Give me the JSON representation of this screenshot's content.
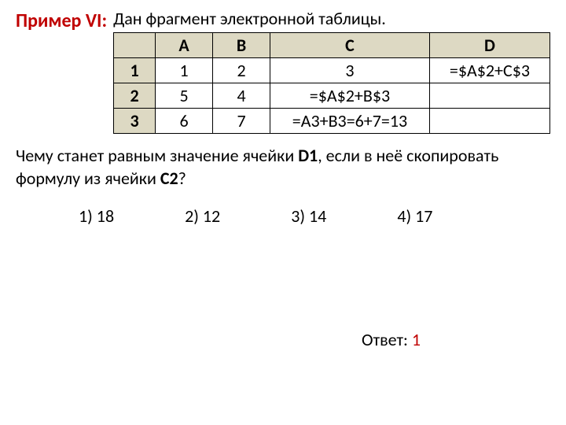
{
  "header": {
    "example_label": "Пример VI:",
    "intro": "Дан фрагмент электронной таблицы."
  },
  "table": {
    "cols": [
      "A",
      "B",
      "C",
      "D"
    ],
    "rows": [
      {
        "n": "1",
        "a": "1",
        "b": "2",
        "c": "3",
        "d": "=$A$2+C$3"
      },
      {
        "n": "2",
        "a": "5",
        "b": "4",
        "c": "=$A$2+B$3",
        "d": ""
      },
      {
        "n": "3",
        "a": "6",
        "b": "7",
        "c": "=A3+B3=6+7=13",
        "d": ""
      }
    ]
  },
  "question": {
    "line1_a": "Чему станет равным значение ячейки ",
    "line1_b": "D1",
    "line1_c": ", если в неё скопировать",
    "line2_a": "формулу из ячейки ",
    "line2_b": "C2",
    "line2_c": "?"
  },
  "options": {
    "o1": "1) 18",
    "o2": "2) 12",
    "o3": "3) 14",
    "o4": "4) 17"
  },
  "answer": {
    "label": "Ответ: ",
    "value": "1"
  }
}
